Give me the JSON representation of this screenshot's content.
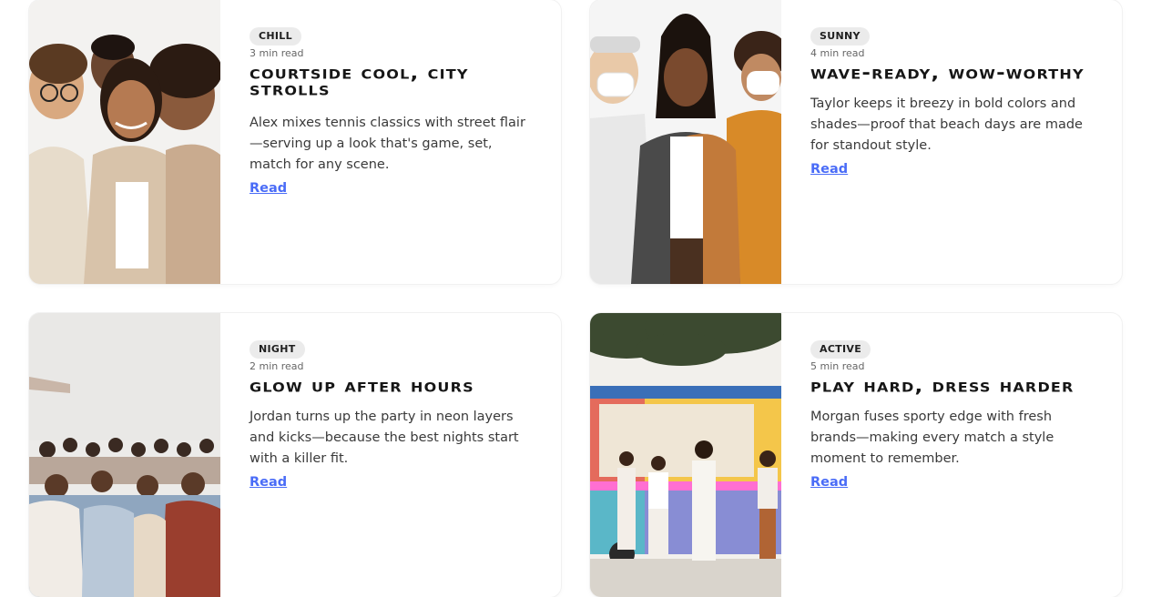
{
  "cards": [
    {
      "tag": "CHILL",
      "read_time": "3 min read",
      "title": "Courtside Cool, City Strolls",
      "description": "Alex mixes tennis classics with street flair—serving up a look that's game, set, match for any scene.",
      "link": "Read"
    },
    {
      "tag": "SUNNY",
      "read_time": "4 min read",
      "title": "Wave-Ready, Wow-Worthy",
      "description": "Taylor keeps it breezy in bold colors and shades—proof that beach days are made for standout style.",
      "link": "Read"
    },
    {
      "tag": "NIGHT",
      "read_time": "2 min read",
      "title": "Glow Up After Hours",
      "description": "Jordan turns up the party in neon layers and kicks—because the best nights start with a killer fit.",
      "link": "Read"
    },
    {
      "tag": "ACTIVE",
      "read_time": "5 min read",
      "title": "Play Hard, Dress Harder",
      "description": "Morgan fuses sporty edge with fresh brands—making every match a style moment to remember.",
      "link": "Read"
    }
  ],
  "colors": {
    "link": "#4a6cf7",
    "tag_bg": "#ebebeb"
  }
}
